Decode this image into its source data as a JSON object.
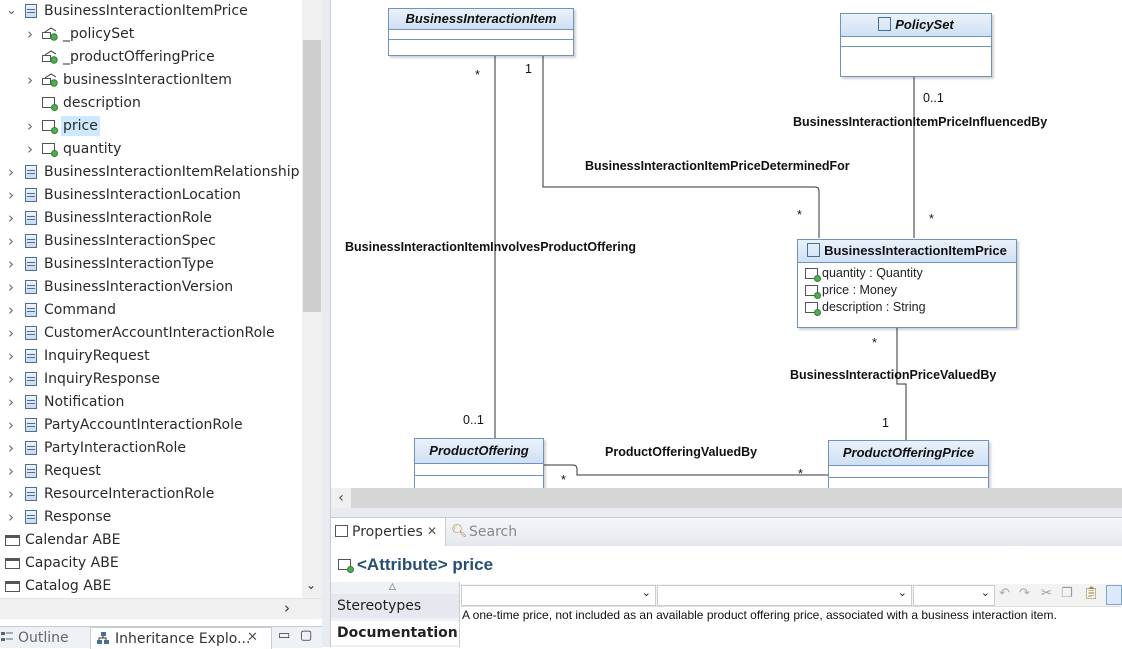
{
  "tree": {
    "items": [
      {
        "label": "BusinessInteractionItemPrice",
        "icon": "class-icon",
        "twisty": "expanded",
        "indent": 0
      },
      {
        "label": "_policySet",
        "icon": "association-end-icon",
        "twisty": "collapsed",
        "indent": 1
      },
      {
        "label": "_productOfferingPrice",
        "icon": "association-end-icon",
        "twisty": "none",
        "indent": 1
      },
      {
        "label": "businessInteractionItem",
        "icon": "association-end-icon",
        "twisty": "collapsed",
        "indent": 1
      },
      {
        "label": "description",
        "icon": "attribute-icon",
        "twisty": "none",
        "indent": 1
      },
      {
        "label": "price",
        "icon": "attribute-icon",
        "twisty": "collapsed",
        "indent": 1,
        "selected": true
      },
      {
        "label": "quantity",
        "icon": "attribute-icon",
        "twisty": "collapsed",
        "indent": 1
      },
      {
        "label": "BusinessInteractionItemRelationship",
        "icon": "class-icon",
        "twisty": "collapsed",
        "indent": 0
      },
      {
        "label": "BusinessInteractionLocation",
        "icon": "class-icon",
        "twisty": "collapsed",
        "indent": 0
      },
      {
        "label": "BusinessInteractionRole",
        "icon": "class-icon",
        "twisty": "collapsed",
        "indent": 0
      },
      {
        "label": "BusinessInteractionSpec",
        "icon": "class-icon",
        "twisty": "collapsed",
        "indent": 0
      },
      {
        "label": "BusinessInteractionType",
        "icon": "class-icon",
        "twisty": "collapsed",
        "indent": 0
      },
      {
        "label": "BusinessInteractionVersion",
        "icon": "class-icon",
        "twisty": "collapsed",
        "indent": 0
      },
      {
        "label": "Command",
        "icon": "class-icon",
        "twisty": "collapsed",
        "indent": 0
      },
      {
        "label": "CustomerAccountInteractionRole",
        "icon": "class-icon",
        "twisty": "collapsed",
        "indent": 0
      },
      {
        "label": "InquiryRequest",
        "icon": "class-icon",
        "twisty": "collapsed",
        "indent": 0
      },
      {
        "label": "InquiryResponse",
        "icon": "class-icon",
        "twisty": "collapsed",
        "indent": 0
      },
      {
        "label": "Notification",
        "icon": "class-icon",
        "twisty": "collapsed",
        "indent": 0
      },
      {
        "label": "PartyAccountInteractionRole",
        "icon": "class-icon",
        "twisty": "collapsed",
        "indent": 0
      },
      {
        "label": "PartyInteractionRole",
        "icon": "class-icon",
        "twisty": "collapsed",
        "indent": 0
      },
      {
        "label": "Request",
        "icon": "class-icon",
        "twisty": "collapsed",
        "indent": 0
      },
      {
        "label": "ResourceInteractionRole",
        "icon": "class-icon",
        "twisty": "collapsed",
        "indent": 0
      },
      {
        "label": "Response",
        "icon": "class-icon",
        "twisty": "collapsed",
        "indent": 0
      },
      {
        "label": "Calendar ABE",
        "icon": "folder-icon",
        "twisty": "none",
        "indent": -1
      },
      {
        "label": "Capacity ABE",
        "icon": "folder-icon",
        "twisty": "none",
        "indent": -1
      },
      {
        "label": "Catalog ABE",
        "icon": "folder-icon",
        "twisty": "none",
        "indent": -1
      }
    ]
  },
  "left_tabs": {
    "outline": "Outline",
    "inheritance": "Inheritance Explo..."
  },
  "diagram": {
    "classes": {
      "bii": "BusinessInteractionItem",
      "policy": "PolicySet",
      "biip": "BusinessInteractionItemPrice",
      "po": "ProductOffering",
      "pop": "ProductOfferingPrice"
    },
    "attributes": [
      "quantity : Quantity",
      "price : Money",
      "description : String"
    ],
    "associations": {
      "influenced": "BusinessInteractionItemPriceInfluencedBy",
      "determined": "BusinessInteractionItemPriceDeterminedFor",
      "involves": "BusinessInteractionItemInvolvesProductOffering",
      "valued": "BusinessInteractionPriceValuedBy",
      "po_valued": "ProductOfferingValuedBy"
    },
    "multiplicities": {
      "bii_left": "*",
      "bii_right": "1",
      "policy": "0..1",
      "biip_top_left": "*",
      "biip_top_right": "*",
      "biip_bottom": "*",
      "pop_top": "1",
      "po_top": "0..1",
      "po_right": "*",
      "pop_left": "*"
    }
  },
  "properties": {
    "tab_properties": "Properties",
    "tab_search": "Search",
    "title_kind": "<Attribute>",
    "title_name": "price",
    "side_tabs": [
      "Stereotypes",
      "Documentation"
    ],
    "documentation": "A one-time price, not included as an available product offering price, associated with a business interaction item."
  }
}
